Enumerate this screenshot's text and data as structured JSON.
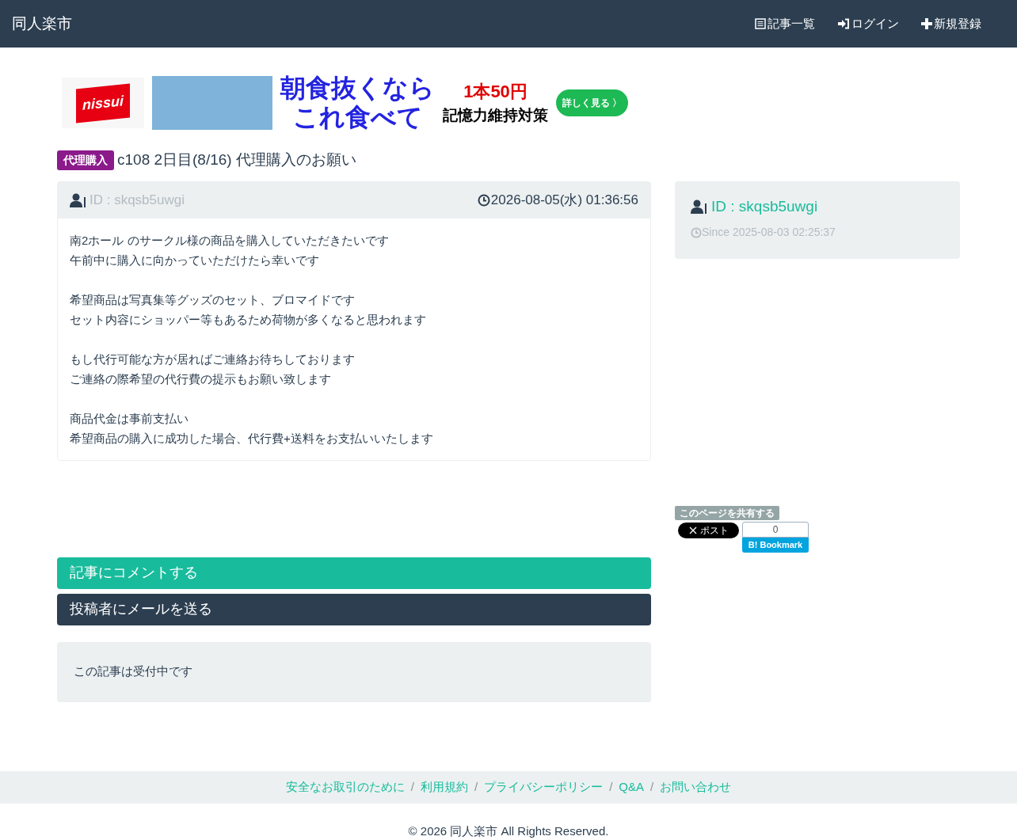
{
  "navbar": {
    "brand": "同人楽市",
    "items": [
      {
        "kind": "list",
        "label": "記事一覧"
      },
      {
        "kind": "login",
        "label": "ログイン"
      },
      {
        "kind": "plus",
        "label": "新規登録"
      }
    ]
  },
  "ad": {
    "logo": "nissui",
    "headline": [
      "朝食抜くなら",
      "これ食べて"
    ],
    "price": "1本50円",
    "tagline": "記憶力維持対策",
    "cta": "詳しく見る 〉"
  },
  "article": {
    "badge": "代理購入",
    "title": "c108 2日目(8/16) 代理購入のお願い",
    "author_id": "ID : skqsb5uwgi",
    "posted": "2026-08-05(水) 01:36:56",
    "paragraphs": [
      [
        "南2ホール のサークル様の商品を購入していただきたいです",
        "午前中に購入に向かっていただけたら幸いです"
      ],
      [
        "希望商品は写真集等グッズのセット、ブロマイドです",
        "セット内容にショッパー等もあるため荷物が多くなると思われます"
      ],
      [
        "もし代行可能な方が居ればご連絡お待ちしております",
        "ご連絡の際希望の代行費の提示もお願い致します"
      ],
      [
        "商品代金は事前支払い",
        "希望商品の購入に成功した場合、代行費+送料をお支払いいたします"
      ]
    ]
  },
  "actions": [
    {
      "kind": "comment",
      "label": "記事にコメントする"
    },
    {
      "kind": "mail",
      "label": "投稿者にメールを送る"
    }
  ],
  "status_notice": "この記事は受付中です",
  "profile": {
    "id": "ID : skqsb5uwgi",
    "since": "Since 2025-08-03 02:25:37"
  },
  "share": {
    "label": "このページを共有する",
    "x_button": "ポスト",
    "bookmark_count": "0",
    "bookmark_logo": "B!",
    "bookmark_label": "Bookmark"
  },
  "footer": {
    "separator": "/",
    "links": [
      "安全なお取引のために",
      "利用規約",
      "プライバシーポリシー",
      "Q&A",
      "お問い合わせ"
    ],
    "copyright": "© 2026 同人楽市 All Rights Reserved."
  }
}
